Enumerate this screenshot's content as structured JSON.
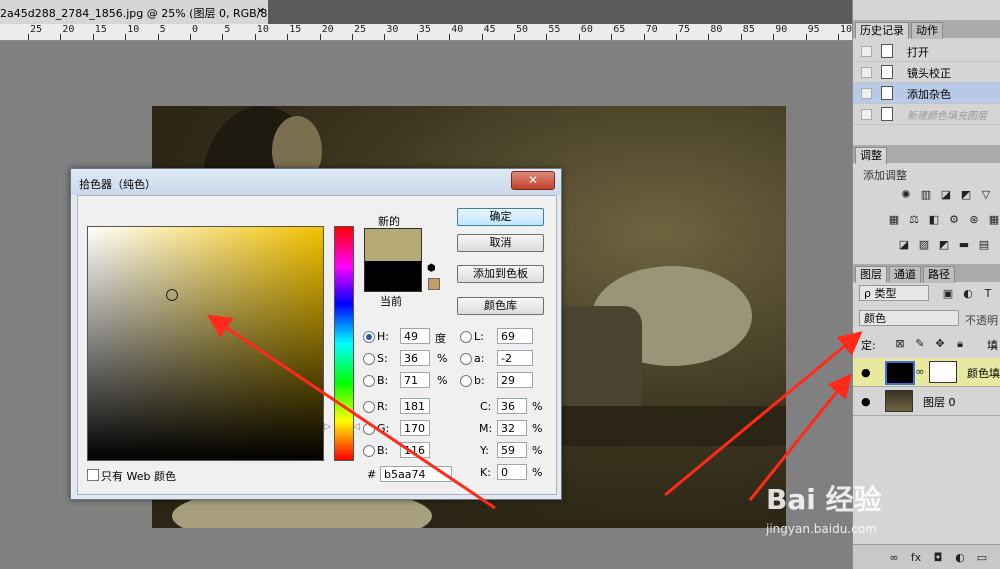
{
  "document": {
    "tab_title": "2a45d288_2784_1856.jpg @ 25% (图层 0, RGB/8#) *",
    "close_glyph": "×",
    "ruler_labels": [
      "25",
      "20",
      "15",
      "10",
      "5",
      "0",
      "5",
      "10",
      "15",
      "20",
      "25",
      "30",
      "35",
      "40",
      "45",
      "50",
      "55",
      "60",
      "65",
      "70",
      "75",
      "80",
      "85",
      "90",
      "95",
      "100",
      "105"
    ]
  },
  "color_picker": {
    "title": "拾色器（纯色）",
    "close_glyph": "✕",
    "label_new": "新的",
    "label_current": "当前",
    "new_color": "#b5aa74",
    "current_color": "#000000",
    "buttons": {
      "ok": "确定",
      "cancel": "取消",
      "add_to_swatches": "添加到色板",
      "color_libraries": "颜色库"
    },
    "fields": {
      "H": {
        "label": "H:",
        "value": "49",
        "unit": "度"
      },
      "S": {
        "label": "S:",
        "value": "36",
        "unit": "%"
      },
      "B": {
        "label": "B:",
        "value": "71",
        "unit": "%"
      },
      "R": {
        "label": "R:",
        "value": "181"
      },
      "G": {
        "label": "G:",
        "value": "170"
      },
      "B2": {
        "label": "B:",
        "value": "116"
      },
      "L": {
        "label": "L:",
        "value": "69"
      },
      "a": {
        "label": "a:",
        "value": "-2"
      },
      "b": {
        "label": "b:",
        "value": "29"
      },
      "C": {
        "label": "C:",
        "value": "36",
        "unit": "%"
      },
      "M": {
        "label": "M:",
        "value": "32",
        "unit": "%"
      },
      "Y": {
        "label": "Y:",
        "value": "59",
        "unit": "%"
      },
      "K": {
        "label": "K:",
        "value": "0",
        "unit": "%"
      }
    },
    "hex_label": "#",
    "hex_value": "b5aa74",
    "web_only_label": "只有 Web 颜色"
  },
  "history_panel": {
    "tabs": [
      "历史记录",
      "动作"
    ],
    "items": [
      {
        "label": "打开"
      },
      {
        "label": "镜头校正"
      },
      {
        "label": "添加杂色"
      },
      {
        "label": "新建颜色填充图层"
      }
    ]
  },
  "adjustments_panel": {
    "tab": "调整",
    "label": "添加调整",
    "icons_row1": [
      "✺",
      "▥",
      "◪",
      "◩",
      "▽"
    ],
    "icons_row2": [
      "▦",
      "⚖",
      "◧",
      "⚙",
      "⊛",
      "▦"
    ],
    "icons_row3": [
      "◪",
      "▨",
      "◩",
      "▬",
      "▤"
    ]
  },
  "layers_panel": {
    "tabs": [
      "图层",
      "通道",
      "路径"
    ],
    "filter_label": "ρ 类型",
    "blend_mode": "颜色",
    "opacity_label": "不透明",
    "lock_label": "定:",
    "fill_label": "填",
    "layers": [
      {
        "name": "颜色填",
        "eye": "●"
      },
      {
        "name": "图层 0",
        "eye": "●"
      }
    ],
    "bottom_icons": [
      "∞",
      "fx",
      "◘",
      "◐",
      "▭"
    ]
  },
  "watermark": {
    "word": "Bai 经验",
    "url": "jingyan.baidu.com"
  },
  "accent_colors": {
    "annotation_arrow": "#ff2a1a",
    "selection": "#b8c9e8"
  }
}
